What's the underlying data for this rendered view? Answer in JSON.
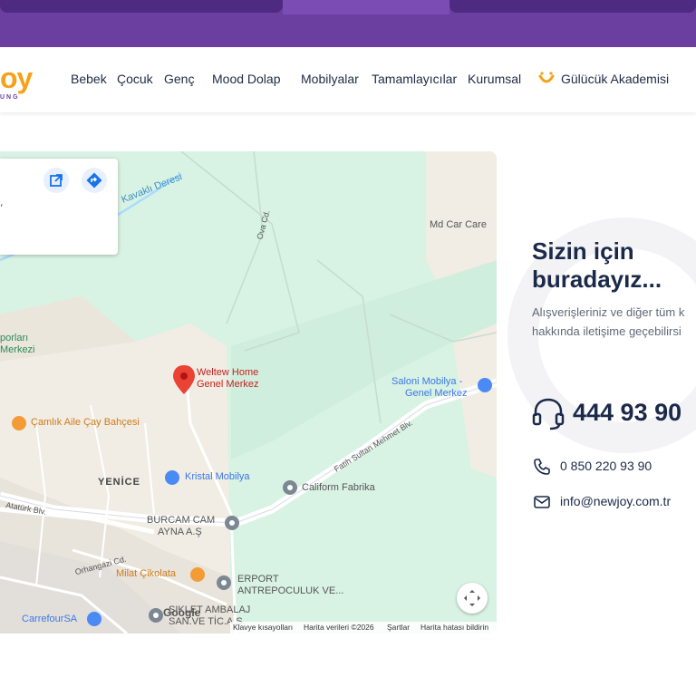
{
  "brand": {
    "logo_text": "oy",
    "logo_sub": "UNG",
    "colors": {
      "purple": "#6a3fa0",
      "orange": "#f5a21a",
      "navy": "#1b2a4a"
    }
  },
  "nav": {
    "items": [
      "Bebek",
      "Çocuk",
      "Genç",
      "Mood Dolap",
      "Mobilyalar",
      "Tamamlayıcılar",
      "Kurumsal",
      "Gülücük Akademisi"
    ]
  },
  "map": {
    "labels": {
      "kavakli": "Kavaklı Deresi",
      "ova": "Ova Cd.",
      "mdcar": "Md Car Care",
      "sporlari": "porları",
      "merkezi": "Merkezi",
      "weltew_1": "Weltew Home",
      "weltew_2": "Genel Merkez",
      "saloni_1": "Saloni Mobilya -",
      "saloni_2": "Genel Merkez",
      "camlik": "Çamlık Aile Çay Bahçesi",
      "fatih": "Fatih Sultan Mehmet Blv.",
      "yenice": "YENİCE",
      "kristal": "Kristal Mobilya",
      "caliform": "Caliform Fabrika",
      "ataturk": "Atatürk Blv.",
      "burcam_1": "BURCAM CAM",
      "burcam_2": "AYNA A.Ş",
      "orhangazi": "Orhangazi Cd.",
      "milat": "Milat Çikolata",
      "erport_1": "ERPORT",
      "erport_2": "ANTREPOCULUK VE...",
      "carrefour": "CarrefourSA",
      "ambalaj_1": "ŞIKLET AMBALAJ",
      "ambalaj_2": "SAN.VE TİC.A.Ş.",
      "comma": ","
    },
    "google": "Google",
    "footer": [
      "Klavye kısayolları",
      "Harita verileri ©2026",
      "Şartlar",
      "Harita hatası bildirin"
    ]
  },
  "contact": {
    "title": "Sizin için buradayız...",
    "subtitle_1": "Alışverişleriniz ve diğer tüm k",
    "subtitle_2": "hakkında iletişime geçebilirsi",
    "call_center": "444 93 90",
    "phone": "0 850 220 93 90",
    "email": "info@newjoy.com.tr"
  }
}
